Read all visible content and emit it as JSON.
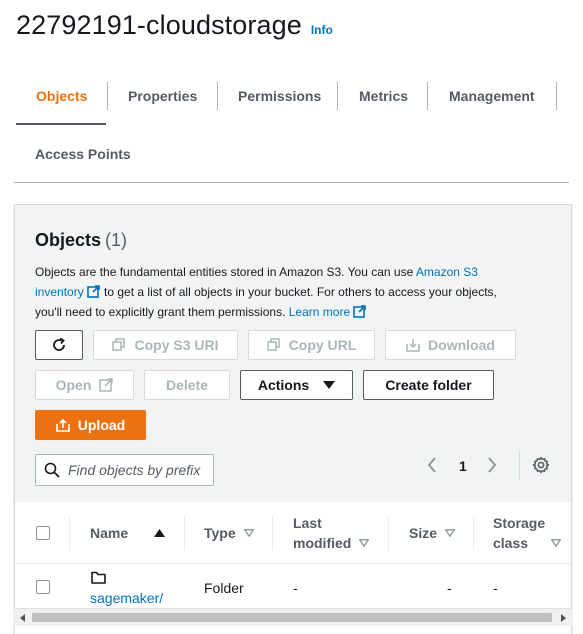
{
  "header": {
    "bucket_name": "22792191-cloudstorage",
    "info_link": "Info"
  },
  "tabs": [
    {
      "label": "Objects",
      "active": true
    },
    {
      "label": "Properties",
      "active": false
    },
    {
      "label": "Permissions",
      "active": false
    },
    {
      "label": "Metrics",
      "active": false
    },
    {
      "label": "Management",
      "active": false
    },
    {
      "label": "Access Points",
      "active": false
    }
  ],
  "objects_panel": {
    "heading": "Objects",
    "count": "(1)",
    "description_part1": "Objects are the fundamental entities stored in Amazon S3. You can use ",
    "description_link1": "Amazon S3 inventory",
    "description_part2": " to get a list of all objects in your bucket. For others to access your objects, you'll need to explicitly grant them permissions. ",
    "description_link2": "Learn more"
  },
  "actions": {
    "refresh_icon": "refresh-icon",
    "copy_s3_uri": "Copy S3 URI",
    "copy_url": "Copy URL",
    "download": "Download",
    "open": "Open",
    "delete": "Delete",
    "actions": "Actions",
    "create_folder": "Create folder",
    "upload": "Upload"
  },
  "search": {
    "placeholder": "Find objects by prefix",
    "value": ""
  },
  "pagination": {
    "current_page": "1"
  },
  "table": {
    "columns": {
      "name": "Name",
      "type": "Type",
      "last_modified_line1": "Last",
      "last_modified_line2": "modified",
      "size": "Size",
      "storage_class_line1": "Storage",
      "storage_class_line2": "class"
    },
    "rows": [
      {
        "name": "sagemaker/",
        "type": "Folder",
        "last_modified": "-",
        "size": "-",
        "storage_class": "-"
      }
    ]
  },
  "colors": {
    "accent_orange": "#ec7211",
    "link_blue": "#0073bb",
    "text_dark": "#16191f",
    "text_gray": "#545b64",
    "disabled_gray": "#aab7b8",
    "panel_bg": "#f2f3f3"
  }
}
